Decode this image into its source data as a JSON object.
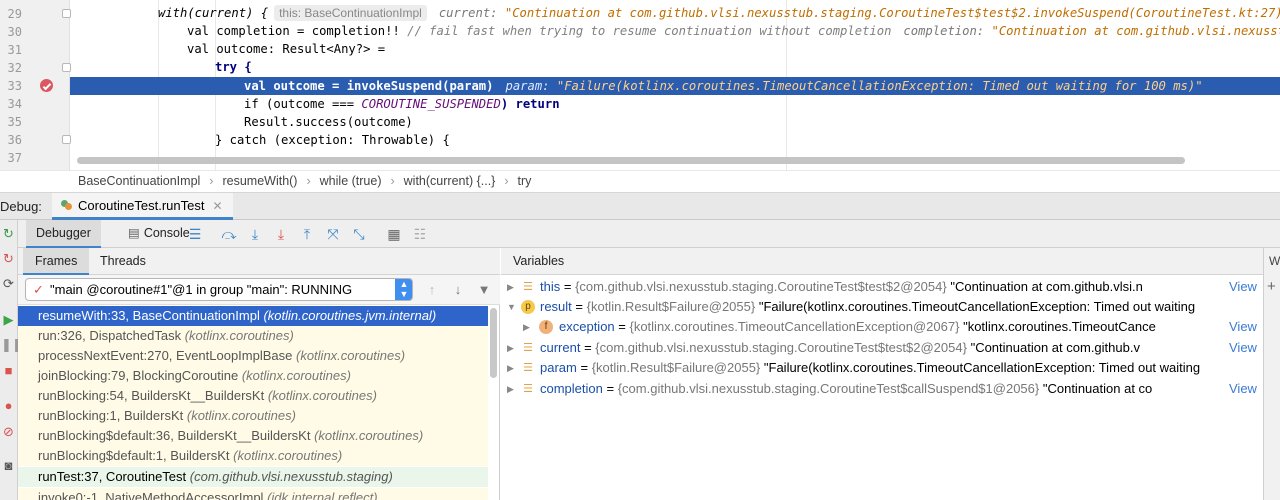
{
  "editor": {
    "line_numbers": [
      "29",
      "30",
      "31",
      "32",
      "33",
      "34",
      "35",
      "36",
      "37"
    ],
    "lines": {
      "l29_code": "with(current) {",
      "l29_hint": "this: BaseContinuationImpl",
      "l29_inlay_label": "current: ",
      "l29_inlay_value": "\"Continuation at com.github.vlsi.nexusstub.staging.CoroutineTest$test$2.invokeSuspend(CoroutineTest.kt:27)\"",
      "l30_code": "val completion = completion!!",
      "l30_comment": "// fail fast when trying to resume continuation without completion",
      "l30_inlay_label": "completion: ",
      "l30_inlay_value": "\"Continuation at com.github.vlsi.nexusstub.",
      "l31_code": "val outcome: Result<Any?> =",
      "l32_code": "try {",
      "l33_code": "val outcome = invokeSuspend(param)",
      "l33_inlay_label": "param: ",
      "l33_inlay_value": "\"Failure(kotlinx.coroutines.TimeoutCancellationException: Timed out waiting for 100 ms)\"",
      "l34_code_a": "if (outcome === ",
      "l34_code_b": "COROUTINE_SUSPENDED",
      "l34_code_c": ") return",
      "l35_code": "Result.success(outcome)",
      "l36_code": "} catch (exception: Throwable) {"
    }
  },
  "breadcrumb": [
    "BaseContinuationImpl",
    "resumeWith()",
    "while (true)",
    "with(current) {...}",
    "try"
  ],
  "debug": {
    "label": "Debug:",
    "run_tab": "CoroutineTest.runTest",
    "subtabs": {
      "debugger": "Debugger",
      "console": "Console"
    }
  },
  "frames": {
    "tabs": {
      "frames": "Frames",
      "threads": "Threads"
    },
    "thread": "\"main @coroutine#1\"@1 in group \"main\": RUNNING",
    "items": [
      {
        "name": "resumeWith:33, BaseContinuationImpl",
        "pkg": "(kotlin.coroutines.jvm.internal)"
      },
      {
        "name": "run:326, DispatchedTask",
        "pkg": "(kotlinx.coroutines)"
      },
      {
        "name": "processNextEvent:270, EventLoopImplBase",
        "pkg": "(kotlinx.coroutines)"
      },
      {
        "name": "joinBlocking:79, BlockingCoroutine",
        "pkg": "(kotlinx.coroutines)"
      },
      {
        "name": "runBlocking:54, BuildersKt__BuildersKt",
        "pkg": "(kotlinx.coroutines)"
      },
      {
        "name": "runBlocking:1, BuildersKt",
        "pkg": "(kotlinx.coroutines)"
      },
      {
        "name": "runBlocking$default:36, BuildersKt__BuildersKt",
        "pkg": "(kotlinx.coroutines)"
      },
      {
        "name": "runBlocking$default:1, BuildersKt",
        "pkg": "(kotlinx.coroutines)"
      },
      {
        "name": "runTest:37, CoroutineTest",
        "pkg": "(com.github.vlsi.nexusstub.staging)"
      },
      {
        "name": "invoke0:-1, NativeMethodAccessorImpl",
        "pkg": "(jdk.internal.reflect)"
      }
    ]
  },
  "variables": {
    "header": "Variables",
    "right_label": "W",
    "view_label": "View",
    "items": [
      {
        "name": "this",
        "type": "{com.github.vlsi.nexusstub.staging.CoroutineTest$test$2@2054}",
        "value": "\"Continuation at com.github.vlsi.n"
      },
      {
        "name": "result",
        "type": "{kotlin.Result$Failure@2055}",
        "value": "\"Failure(kotlinx.coroutines.TimeoutCancellationException: Timed out waiting"
      },
      {
        "name": "exception",
        "type": "{kotlinx.coroutines.TimeoutCancellationException@2067}",
        "value": "\"kotlinx.coroutines.TimeoutCance"
      },
      {
        "name": "current",
        "type": "{com.github.vlsi.nexusstub.staging.CoroutineTest$test$2@2054}",
        "value": "\"Continuation at com.github.v"
      },
      {
        "name": "param",
        "type": "{kotlin.Result$Failure@2055}",
        "value": "\"Failure(kotlinx.coroutines.TimeoutCancellationException: Timed out waiting"
      },
      {
        "name": "completion",
        "type": "{com.github.vlsi.nexusstub.staging.CoroutineTest$callSuspend$1@2056}",
        "value": "\"Continuation at co"
      }
    ]
  }
}
